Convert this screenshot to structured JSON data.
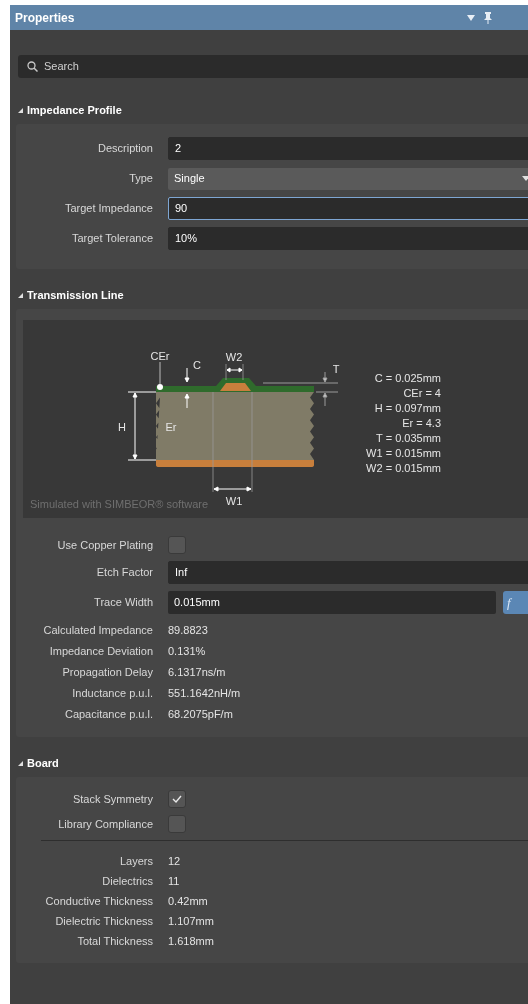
{
  "panel": {
    "title": "Properties"
  },
  "search": {
    "placeholder": "Search"
  },
  "sections": [
    {
      "title": "Impedance Profile",
      "expanded": true,
      "rows": [
        {
          "kind": "field",
          "label": "Description",
          "value": "2",
          "focused": false
        },
        {
          "kind": "dropdown",
          "label": "Type",
          "value": "Single"
        },
        {
          "kind": "field",
          "label": "Target Impedance",
          "value": "90",
          "focused": true
        },
        {
          "kind": "field",
          "label": "Target Tolerance",
          "value": "10%",
          "focused": false
        }
      ]
    },
    {
      "title": "Transmission Line",
      "expanded": true,
      "diagram": {
        "labels": {
          "cer": "CEr",
          "c": "C",
          "w2": "W2",
          "t": "T",
          "h": "H",
          "er": "Er",
          "w1": "W1"
        },
        "values": [
          "C = 0.025mm",
          "CEr = 4",
          "H = 0.097mm",
          "Er = 4.3",
          "T = 0.035mm",
          "W1 = 0.015mm",
          "W2 = 0.015mm"
        ],
        "caption": "Simulated with SIMBEOR® software"
      },
      "rows": [
        {
          "kind": "checkbox",
          "label": "Use Copper Plating",
          "checked": false
        },
        {
          "kind": "field",
          "label": "Etch Factor",
          "value": "Inf",
          "focused": false
        },
        {
          "kind": "formula_field",
          "label": "Trace Width",
          "value": "0.015mm",
          "button": "f"
        },
        {
          "kind": "readout",
          "label": "Calculated Impedance",
          "value": "89.8823"
        },
        {
          "kind": "readout",
          "label": "Impedance Deviation",
          "value": "0.131%"
        },
        {
          "kind": "readout",
          "label": "Propagation Delay",
          "value": "6.1317ns/m"
        },
        {
          "kind": "readout",
          "label": "Inductance p.u.l.",
          "value": "551.1642nH/m"
        },
        {
          "kind": "readout",
          "label": "Capacitance p.u.l.",
          "value": "68.2075pF/m"
        }
      ]
    },
    {
      "title": "Board",
      "expanded": true,
      "rows": [
        {
          "kind": "checkbox",
          "label": "Stack Symmetry",
          "checked": true
        },
        {
          "kind": "checkbox",
          "label": "Library Compliance",
          "checked": false
        },
        {
          "kind": "divider"
        },
        {
          "kind": "stat",
          "label": "Layers",
          "value": "12"
        },
        {
          "kind": "stat",
          "label": "Dielectrics",
          "value": "11"
        },
        {
          "kind": "stat",
          "label": "Conductive Thickness",
          "value": "0.42mm"
        },
        {
          "kind": "stat",
          "label": "Dielectric Thickness",
          "value": "1.107mm"
        },
        {
          "kind": "stat",
          "label": "Total Thickness",
          "value": "1.618mm"
        }
      ]
    }
  ]
}
